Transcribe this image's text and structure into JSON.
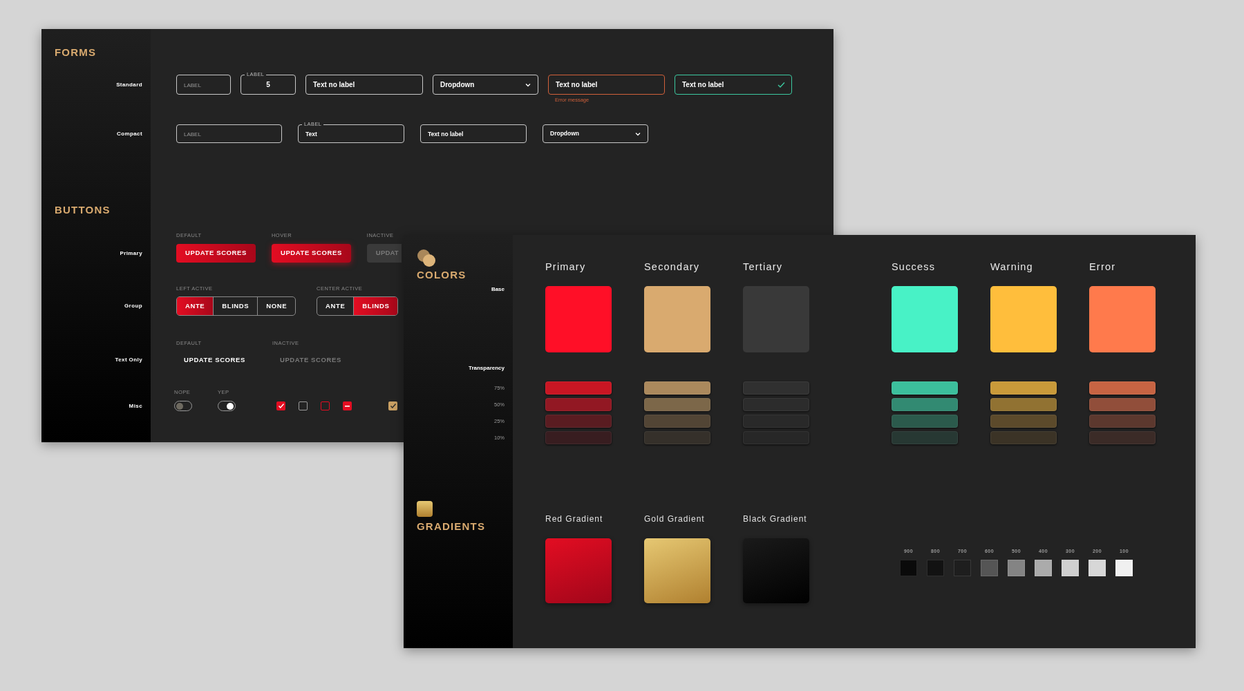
{
  "forms": {
    "title": "FORMS",
    "rows": [
      {
        "label": "Standard",
        "compact": false,
        "fields": [
          {
            "kind": "placeholder",
            "placeholder": "LABEL"
          },
          {
            "kind": "floating",
            "label": "LABEL",
            "value": "5"
          },
          {
            "kind": "text",
            "value": "Text no label"
          },
          {
            "kind": "dropdown",
            "value": "Dropdown"
          },
          {
            "kind": "error",
            "value": "Text no label",
            "message": "Error message"
          },
          {
            "kind": "success",
            "value": "Text no label"
          }
        ]
      },
      {
        "label": "Compact",
        "compact": true,
        "fields": [
          {
            "kind": "placeholder",
            "placeholder": "LABEL"
          },
          {
            "kind": "floating",
            "label": "LABEL",
            "value": "Text"
          },
          {
            "kind": "text",
            "value": "Text no label"
          },
          {
            "kind": "dropdown",
            "value": "Dropdown"
          }
        ]
      }
    ]
  },
  "buttons": {
    "title": "BUTTONS",
    "primary": {
      "label": "Primary",
      "items": [
        {
          "caption": "DEFAULT",
          "text": "UPDATE SCORES",
          "hovered": false,
          "disabled": false
        },
        {
          "caption": "HOVER",
          "text": "UPDATE SCORES",
          "hovered": true,
          "disabled": false
        },
        {
          "caption": "INACTIVE",
          "text": "UPDAT",
          "hovered": false,
          "disabled": true
        }
      ]
    },
    "group": {
      "label": "Group",
      "items": [
        {
          "caption": "LEFT ACTIVE",
          "options": [
            {
              "text": "ANTE",
              "selected": true
            },
            {
              "text": "BLINDS",
              "selected": false
            },
            {
              "text": "NONE",
              "selected": false
            }
          ]
        },
        {
          "caption": "CENTER ACTIVE",
          "options": [
            {
              "text": "ANTE",
              "selected": false
            },
            {
              "text": "BLINDS",
              "selected": true
            }
          ]
        }
      ]
    },
    "text_only": {
      "label": "Text Only",
      "items": [
        {
          "caption": "DEFAULT",
          "text": "UPDATE SCORES",
          "disabled": false
        },
        {
          "caption": "INACTIVE",
          "text": "UPDATE SCORES",
          "disabled": true
        }
      ]
    },
    "misc": {
      "label": "Misc",
      "toggles": [
        {
          "caption": "NOPE",
          "on": false
        },
        {
          "caption": "YEP",
          "on": true
        }
      ],
      "checkboxes": [
        {
          "checked": true,
          "color": "#e30d22"
        },
        {
          "checked": false,
          "color": "#9a9a9a"
        },
        {
          "checked": false,
          "color": "#e30d22"
        },
        {
          "checked": true,
          "indeterminate": true,
          "color": "#e30d22"
        }
      ],
      "accent_checkboxes": [
        {
          "checked": true,
          "color": "#c9a063"
        }
      ]
    }
  },
  "colors": {
    "title": "COLORS",
    "base_label": "Base",
    "transparency_label": "Transparency",
    "transparency_steps": [
      "75%",
      "50%",
      "25%",
      "10%"
    ],
    "brand_colors": [
      {
        "name": "Primary",
        "color": "#ff0f27",
        "tints": [
          {
            "color": "#c91623"
          },
          {
            "color": "#921823"
          },
          {
            "color": "#5a1c21"
          },
          {
            "color": "#381d20"
          }
        ]
      },
      {
        "name": "Secondary",
        "color": "#d9aa6f",
        "tints": [
          {
            "color": "#ab895d"
          },
          {
            "color": "#7c6749"
          },
          {
            "color": "#524535"
          },
          {
            "color": "#35302a"
          }
        ]
      },
      {
        "name": "Tertiary",
        "color": "#393939",
        "tints": [
          {
            "color": "#303030"
          },
          {
            "color": "#2c2c2c"
          },
          {
            "color": "#292929"
          },
          {
            "color": "#272727"
          }
        ]
      }
    ],
    "status_colors": [
      {
        "name": "Success",
        "color": "#48f2c6",
        "tints": [
          {
            "color": "#3cbf9c"
          },
          {
            "color": "#328a72"
          },
          {
            "color": "#2b5a4c"
          },
          {
            "color": "#273833"
          }
        ]
      },
      {
        "name": "Warning",
        "color": "#ffbe3c",
        "tints": [
          {
            "color": "#c99a3a"
          },
          {
            "color": "#917232"
          },
          {
            "color": "#5c4a2b"
          },
          {
            "color": "#3b3326"
          }
        ]
      },
      {
        "name": "Error",
        "color": "#ff7a4c",
        "tints": [
          {
            "color": "#c76443"
          },
          {
            "color": "#914e3a"
          },
          {
            "color": "#5c382e"
          },
          {
            "color": "#3b2b27"
          }
        ]
      }
    ]
  },
  "gradients": {
    "title": "GRADIENTS",
    "items": [
      {
        "name": "Red Gradient",
        "stops": [
          {
            "color": "#e30d22"
          },
          {
            "color": "#a0061a"
          }
        ]
      },
      {
        "name": "Gold Gradient",
        "stops": [
          {
            "color": "#e6c873"
          },
          {
            "color": "#b0802f"
          }
        ]
      },
      {
        "name": "Black Gradient",
        "stops": [
          {
            "color": "#1a1a1a"
          },
          {
            "color": "#000000"
          }
        ]
      }
    ],
    "grays": [
      {
        "label": "900",
        "color": "#0a0a0a"
      },
      {
        "label": "800",
        "color": "#121212"
      },
      {
        "label": "700",
        "color": "#1e1e1e"
      },
      {
        "label": "600",
        "color": "#555555"
      },
      {
        "label": "500",
        "color": "#848484"
      },
      {
        "label": "400",
        "color": "#ababab"
      },
      {
        "label": "300",
        "color": "#cfcfcf"
      },
      {
        "label": "200",
        "color": "#d7d7d7"
      },
      {
        "label": "100",
        "color": "#f0f0f0"
      }
    ]
  }
}
